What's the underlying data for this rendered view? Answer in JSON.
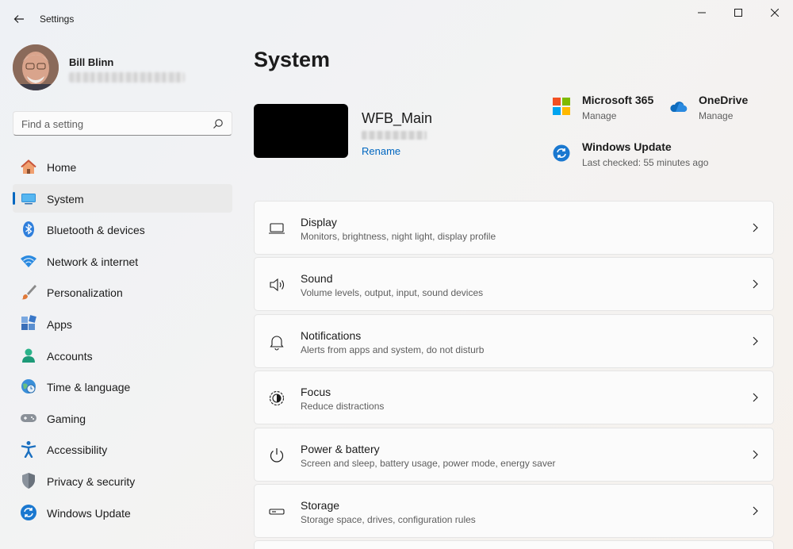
{
  "window": {
    "title": "Settings"
  },
  "profile": {
    "name": "Bill Blinn"
  },
  "search": {
    "placeholder": "Find a setting"
  },
  "sidebar": {
    "items": [
      {
        "label": "Home",
        "icon": "home-icon"
      },
      {
        "label": "System",
        "icon": "system-icon",
        "active": true
      },
      {
        "label": "Bluetooth & devices",
        "icon": "bluetooth-icon"
      },
      {
        "label": "Network & internet",
        "icon": "wifi-icon"
      },
      {
        "label": "Personalization",
        "icon": "brush-icon"
      },
      {
        "label": "Apps",
        "icon": "apps-icon"
      },
      {
        "label": "Accounts",
        "icon": "accounts-icon"
      },
      {
        "label": "Time & language",
        "icon": "globe-clock-icon"
      },
      {
        "label": "Gaming",
        "icon": "controller-icon"
      },
      {
        "label": "Accessibility",
        "icon": "accessibility-icon"
      },
      {
        "label": "Privacy & security",
        "icon": "shield-icon"
      },
      {
        "label": "Windows Update",
        "icon": "update-icon"
      }
    ]
  },
  "main": {
    "title": "System",
    "device": {
      "name": "WFB_Main",
      "rename_label": "Rename"
    },
    "quick_links": {
      "m365": {
        "title": "Microsoft 365",
        "sub": "Manage"
      },
      "onedrive": {
        "title": "OneDrive",
        "sub": "Manage"
      },
      "update": {
        "title": "Windows Update",
        "sub": "Last checked: 55 minutes ago"
      }
    },
    "cards": [
      {
        "title": "Display",
        "sub": "Monitors, brightness, night light, display profile",
        "icon": "display-icon"
      },
      {
        "title": "Sound",
        "sub": "Volume levels, output, input, sound devices",
        "icon": "speaker-icon"
      },
      {
        "title": "Notifications",
        "sub": "Alerts from apps and system, do not disturb",
        "icon": "bell-icon"
      },
      {
        "title": "Focus",
        "sub": "Reduce distractions",
        "icon": "focus-icon"
      },
      {
        "title": "Power & battery",
        "sub": "Screen and sleep, battery usage, power mode, energy saver",
        "icon": "power-icon"
      },
      {
        "title": "Storage",
        "sub": "Storage space, drives, configuration rules",
        "icon": "storage-icon"
      }
    ]
  },
  "colors": {
    "accent": "#0067c0",
    "background": "#f3f3f3",
    "card": "#fbfbfb"
  }
}
